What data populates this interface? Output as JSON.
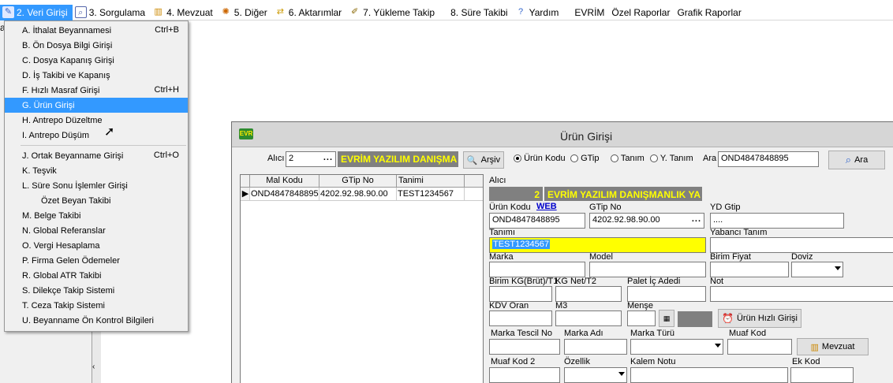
{
  "menubar": {
    "items": [
      {
        "label": "2. Veri Girişi",
        "icon": "edit-icon",
        "color": "#3366cc"
      },
      {
        "label": "3. Sorgulama",
        "icon": "query-icon",
        "color": "#5566aa"
      },
      {
        "label": "4. Mevzuat",
        "icon": "books-icon",
        "color": "#cc8800"
      },
      {
        "label": "5. Diğer",
        "icon": "other-icon",
        "color": "#cc6600"
      },
      {
        "label": "6. Aktarımlar",
        "icon": "transfer-icon",
        "color": "#cc9900"
      },
      {
        "label": "7. Yükleme Takip",
        "icon": "pen-icon",
        "color": "#886600"
      },
      {
        "label": "8. Süre Takibi"
      },
      {
        "label": "Yardım",
        "icon": "help-icon",
        "color": "#3366cc"
      },
      {
        "label": "EVRİM"
      },
      {
        "label": "Özel Raporlar"
      },
      {
        "label": "Grafik Raporlar"
      }
    ]
  },
  "left": {
    "partial_label": "a",
    "arrow": "‹"
  },
  "dropdown": {
    "items": [
      {
        "label": "A.  İthalat Beyannamesi",
        "shortcut": "Ctrl+B"
      },
      {
        "label": "B.  Ön Dosya Bilgi Girişi",
        "shortcut": ""
      },
      {
        "label": "C.  Dosya Kapanış Girişi",
        "shortcut": ""
      },
      {
        "label": "D.  İş Takibi ve Kapanış",
        "shortcut": ""
      },
      {
        "label": "F.  Hızlı Masraf Girişi",
        "shortcut": "Ctrl+H"
      },
      {
        "label": "G.  Ürün Girişi",
        "shortcut": ""
      },
      {
        "label": "H.  Antrepo Düzeltme",
        "shortcut": ""
      },
      {
        "label": "I.  Antrepo Düşüm",
        "shortcut": ""
      },
      {
        "label": "J.  Ortak Beyanname Girişi",
        "shortcut": "Ctrl+O"
      },
      {
        "label": "K.  Teşvik",
        "shortcut": ""
      },
      {
        "label": "L.  Süre Sonu İşlemler Girişi",
        "shortcut": ""
      },
      {
        "label": "Özet Beyan Takibi",
        "shortcut": ""
      },
      {
        "label": "M.  Belge Takibi",
        "shortcut": ""
      },
      {
        "label": "N.  Global Referanslar",
        "shortcut": ""
      },
      {
        "label": "O. Vergi Hesaplama",
        "shortcut": ""
      },
      {
        "label": "P. Firma Gelen Ödemeler",
        "shortcut": ""
      },
      {
        "label": "R. Global ATR Takibi",
        "shortcut": ""
      },
      {
        "label": "S. Dilekçe Takip Sistemi",
        "shortcut": ""
      },
      {
        "label": "T. Ceza Takip Sistemi",
        "shortcut": ""
      },
      {
        "label": "U. Beyanname Ön Kontrol Bilgileri",
        "shortcut": ""
      }
    ]
  },
  "window": {
    "title": "Ürün Girişi",
    "app_icon_text": "EVR",
    "toolbar": {
      "alici_label": "Alıcı",
      "alici_value": "2",
      "company": "EVRİM YAZILIM DANIŞMA",
      "arsiv_label": "Arşiv",
      "radio_options": [
        "Ürün Kodu",
        "GTip",
        "Tanım",
        "Y. Tanım"
      ],
      "ara_label": "Ara",
      "search_value": "OND4847848895",
      "ara_button": "Ara"
    },
    "grid": {
      "columns": [
        "Mal Kodu",
        "GTip No",
        "Tanimi"
      ],
      "rows": [
        [
          "OND4847848895",
          "4202.92.98.90.00",
          "TEST1234567"
        ]
      ]
    },
    "detail": {
      "alici_label": "Alıcı",
      "alici_no": "2",
      "alici_name": "EVRİM YAZILIM DANIŞMANLIK YA",
      "urun_kodu_label": "Ürün Kodu",
      "web_link": "WEB",
      "urun_kodu_value": "OND4847848895",
      "gtip_label": "GTip No",
      "gtip_value": "4202.92.98.90.00",
      "yd_gtip_label": "YD Gtip",
      "yd_gtip_value": "....",
      "tanimi_label": "Tanımı",
      "tanimi_value": "TEST1234567",
      "yabanci_label": "Yabancı Tanım",
      "marka_label": "Marka",
      "model_label": "Model",
      "birim_fiyat_label": "Birim Fiyat",
      "doviz_label": "Doviz",
      "birim_kg_label": "Birim KG(Brüt)/T1",
      "kg_net_label": "KG Net/T2",
      "palet_label": "Palet İç Adedi",
      "not_label": "Not",
      "kdv_label": "KDV Oran",
      "m3_label": "M3",
      "mense_label": "Menşe",
      "hizli_button": "Ürün Hızlı Girişi",
      "marka_tescil_label": "Marka Tescil No",
      "marka_adi_label": "Marka Adı",
      "marka_turu_label": "Marka Türü",
      "muaf_kod_label": "Muaf Kod",
      "mevzuat_button": "Mevzuat",
      "muaf_kod2_label": "Muaf Kod 2",
      "ozellik_label": "Özellik",
      "kalem_notu_label": "Kalem Notu",
      "ek_kod_label": "Ek Kod"
    }
  }
}
